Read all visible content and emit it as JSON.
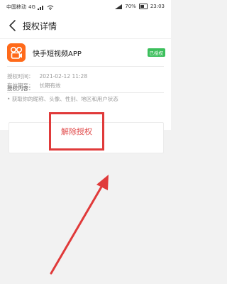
{
  "status_bar": {
    "carrier": "中国移动",
    "network": "4G",
    "battery": "70%",
    "time": "23:03"
  },
  "nav": {
    "title": "授权详情"
  },
  "app": {
    "name": "快手短视频APP",
    "badge": "已授权"
  },
  "auth": {
    "time_label": "授权时间：",
    "time_value": "2021-02-12 11:28",
    "validity_label": "有效期至：",
    "validity_value": "长期有效",
    "content_label": "授权内容：",
    "scope": "获取你的昵称、头像、性别、地区和用户状态"
  },
  "actions": {
    "revoke_label": "解除授权"
  },
  "colors": {
    "accent_orange": "#ff6a1a",
    "badge_green": "#3cbf5c",
    "highlight_red": "#e03a3a"
  }
}
